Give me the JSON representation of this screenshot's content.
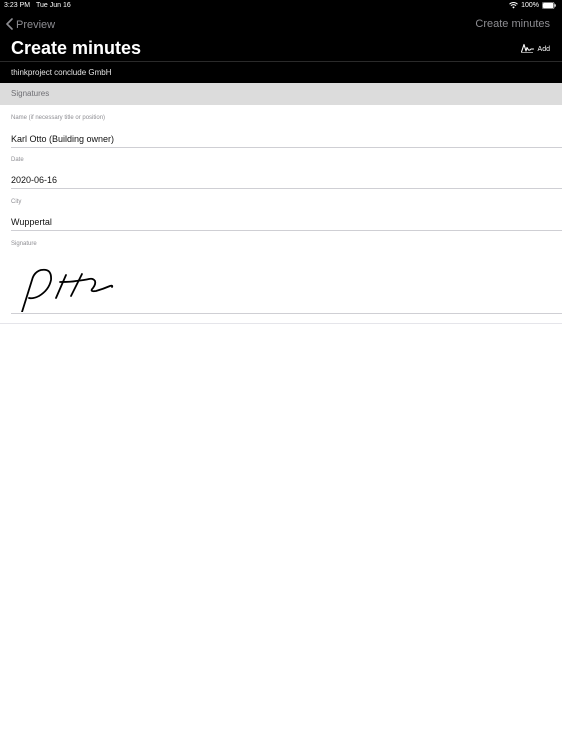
{
  "status_bar": {
    "time": "3:23 PM",
    "date": "Tue Jun 16",
    "battery": "100%"
  },
  "nav": {
    "back_label": "Preview",
    "right_title": "Create minutes",
    "large_title": "Create minutes",
    "add_label": "Add",
    "company": "thinkproject conclude GmbH"
  },
  "section": {
    "title": "Signatures"
  },
  "fields": {
    "name": {
      "label": "Name (if necessary title or position)",
      "value": "Karl Otto (Building owner)"
    },
    "date": {
      "label": "Date",
      "value": "2020-06-16"
    },
    "city": {
      "label": "City",
      "value": "Wuppertal"
    },
    "signature": {
      "label": "Signature"
    }
  },
  "icons": {
    "back": "chevron-left-icon",
    "add": "signature-icon",
    "wifi": "wifi-icon",
    "battery": "battery-icon"
  },
  "colors": {
    "nav_background": "#000000",
    "nav_muted_text": "#8e8e93",
    "section_background": "#dcdcdc"
  }
}
